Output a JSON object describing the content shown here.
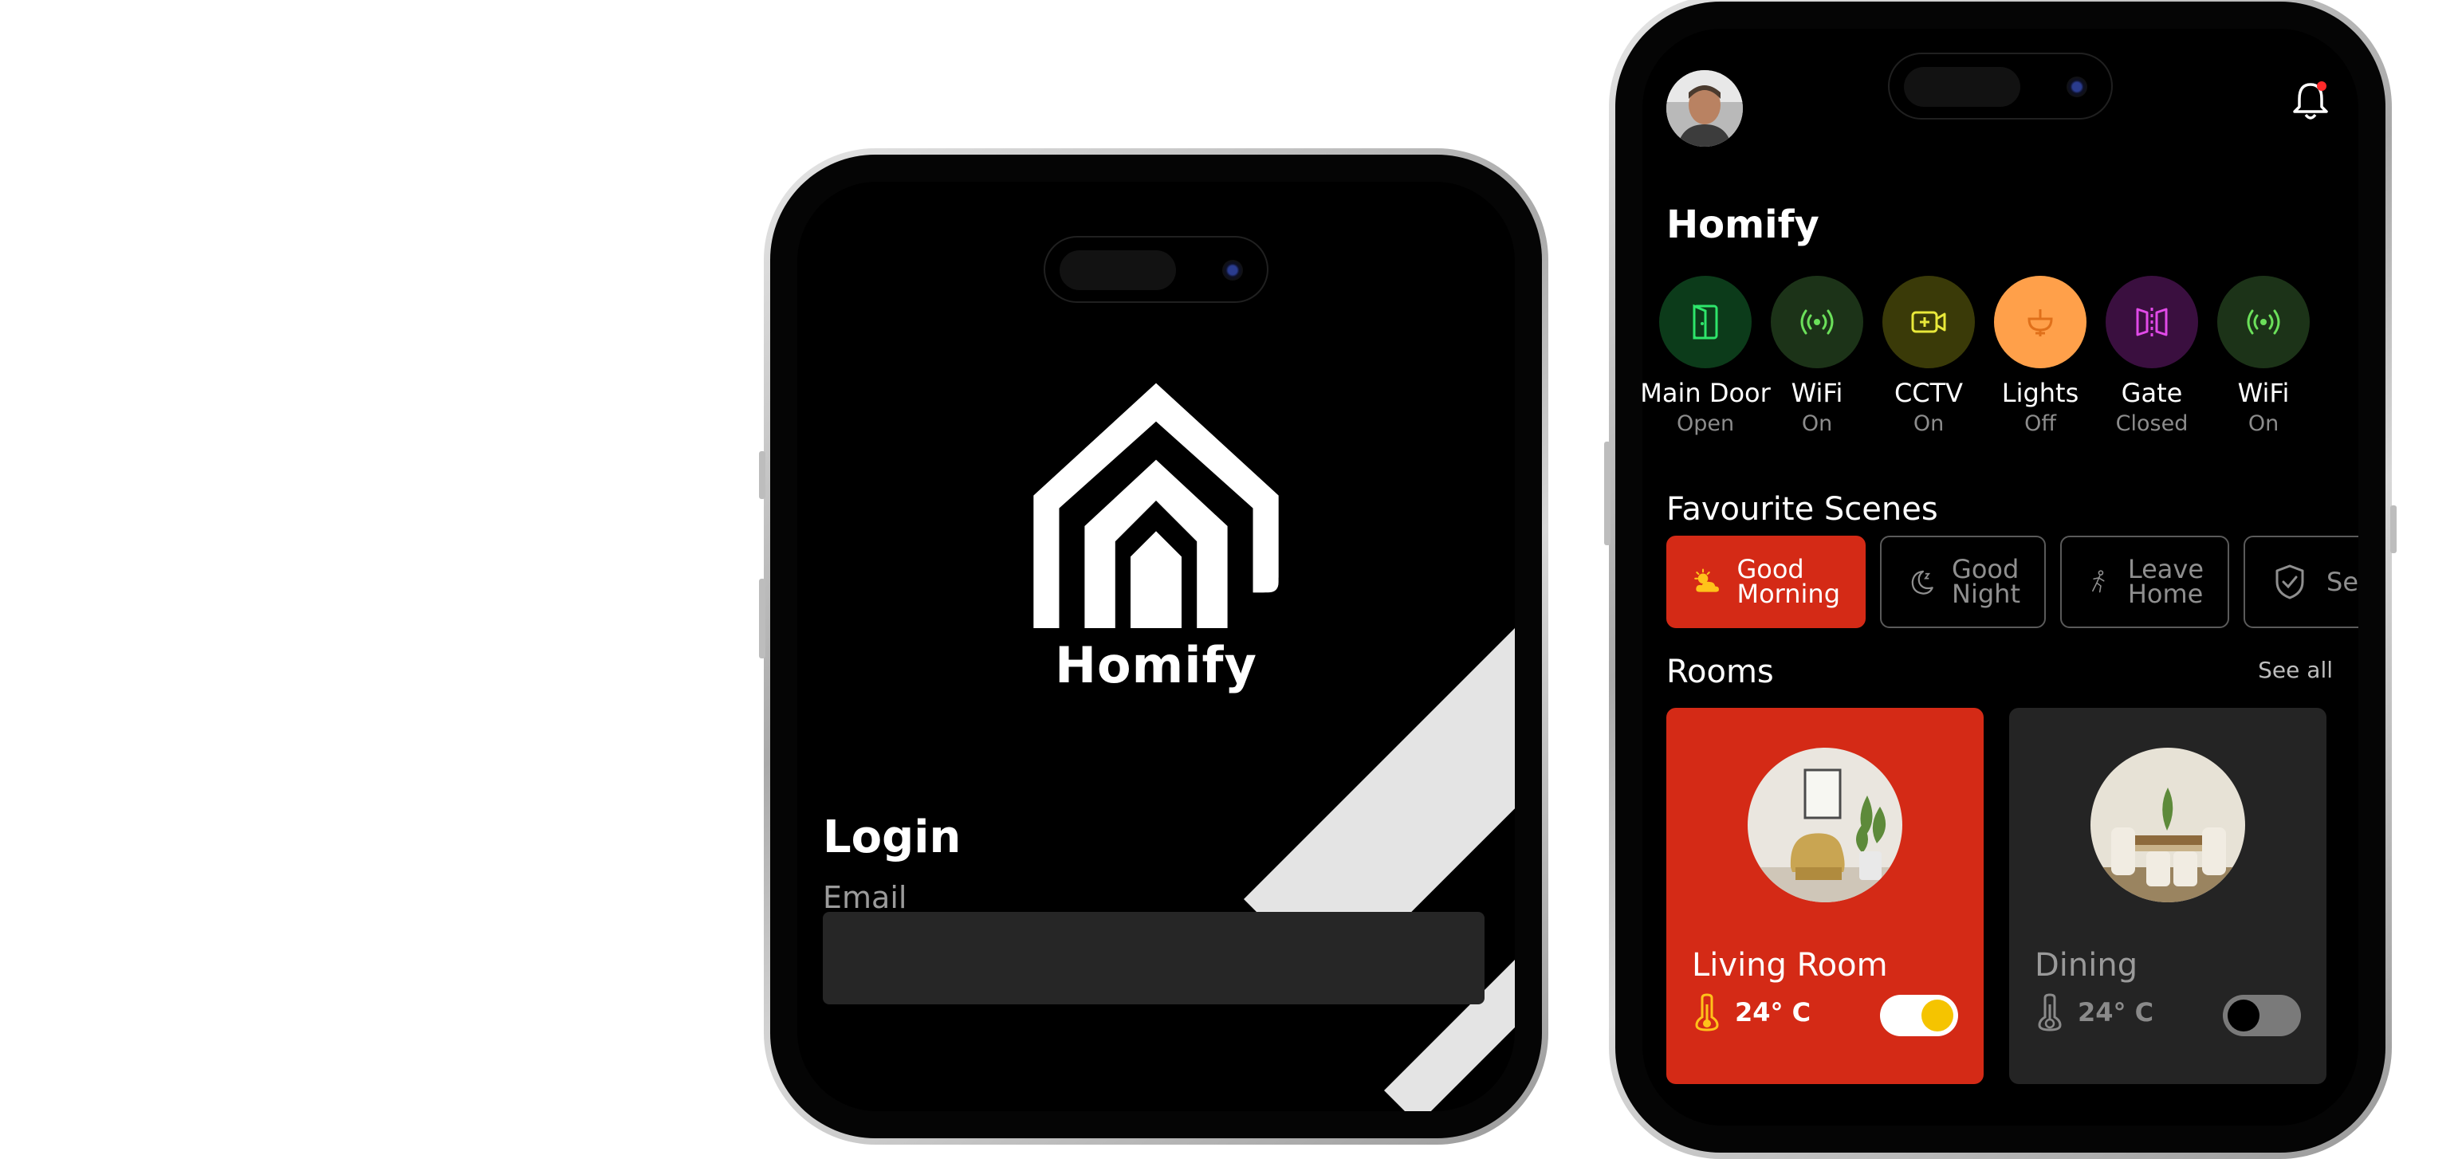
{
  "login": {
    "brand": "Homify",
    "title": "Login",
    "email_label": "Email",
    "email_value": ""
  },
  "home": {
    "app_title": "Homify",
    "devices": [
      {
        "name": "Main Door",
        "status": "Open",
        "icon": "door-icon",
        "bg": "#0c3b1a",
        "fg": "#2ee56b"
      },
      {
        "name": "WiFi",
        "status": "On",
        "icon": "wifi-icon",
        "bg": "#1c3318",
        "fg": "#6be05a"
      },
      {
        "name": "CCTV",
        "status": "On",
        "icon": "cctv-icon",
        "bg": "#3a3a08",
        "fg": "#e8e83a"
      },
      {
        "name": "Lights",
        "status": "Off",
        "icon": "lamp-icon",
        "bg": "#ffa04a",
        "fg": "#e0701a"
      },
      {
        "name": "Gate",
        "status": "Closed",
        "icon": "gate-icon",
        "bg": "#3a0f3f",
        "fg": "#e14ae8"
      },
      {
        "name": "WiFi",
        "status": "On",
        "icon": "wifi-icon",
        "bg": "#1c3318",
        "fg": "#6be05a"
      }
    ],
    "favourite_scenes_title": "Favourite Scenes",
    "scenes": [
      {
        "line1": "Good",
        "line2": "Morning",
        "icon": "sun-cloud-icon",
        "active": true
      },
      {
        "line1": "Good",
        "line2": "Night",
        "icon": "moon-icon",
        "active": false
      },
      {
        "line1": "Leave",
        "line2": "Home",
        "icon": "walking-icon",
        "active": false
      },
      {
        "line1": "Sec",
        "line2": "",
        "icon": "shield-icon",
        "active": false
      }
    ],
    "rooms_title": "Rooms",
    "see_all": "See all",
    "rooms": [
      {
        "name": "Living Room",
        "temp": "24° C",
        "on": true
      },
      {
        "name": "Dining",
        "temp": "24° C",
        "on": false
      }
    ],
    "colors": {
      "accent": "#d42a16",
      "toggle_on": "#f5c400",
      "card_dark": "#242424"
    }
  }
}
